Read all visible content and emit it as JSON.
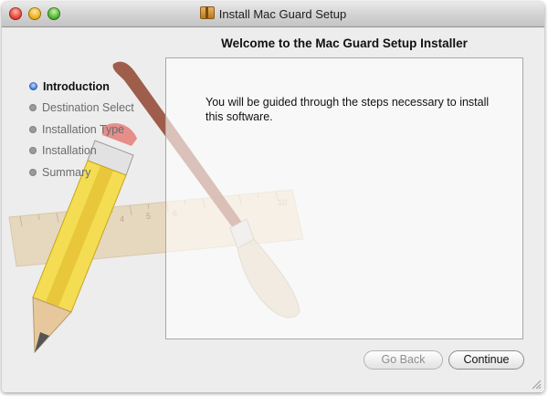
{
  "window": {
    "title": "Install Mac Guard Setup"
  },
  "installer": {
    "heading": "Welcome to the Mac Guard Setup Installer",
    "message": "You will be guided through the steps necessary to install this software.",
    "steps": [
      {
        "label": "Introduction",
        "state": "current"
      },
      {
        "label": "Destination Select",
        "state": "pending"
      },
      {
        "label": "Installation Type",
        "state": "pending"
      },
      {
        "label": "Installation",
        "state": "pending"
      },
      {
        "label": "Summary",
        "state": "pending"
      }
    ]
  },
  "buttons": {
    "back_label": "Go Back",
    "continue_label": "Continue"
  },
  "icons": {
    "window_icon": "package-icon",
    "background_art": "pencil-ruler-brush-icon"
  },
  "colors": {
    "current_step_dot": "#3d73d8",
    "pending_step_dot": "#9a9a9a"
  }
}
